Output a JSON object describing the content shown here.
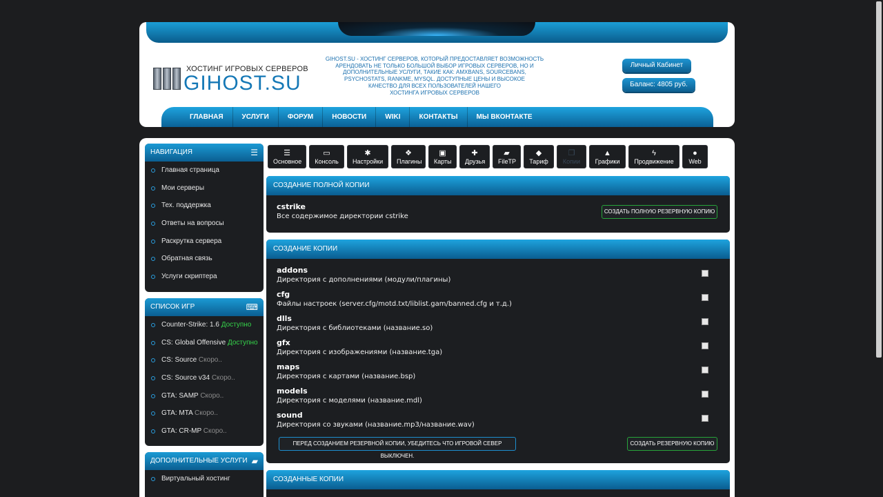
{
  "header": {
    "logo_subtitle": "ХОСТИНГ ИГРОВЫХ СЕРВЕРОВ",
    "logo_name": "GIHOST.SU",
    "description_lines": [
      "GIHOST.SU - ХОСТИНГ СЕРВЕРОВ, КОТОРЫЙ ПРЕДОСТАВЛЯЕТ ВОЗМОЖНОСТЬ",
      "АРЕНДОВАТЬ НЕ ТОЛЬКО БОЛЬШОЙ ВЫБОР ИГРОВЫХ СЕРВЕРОВ, НО И",
      "ДОПОЛНИТЕЛЬНЫЕ УСЛУГИ, ТАКИЕ КАК: AMXBANS, SOURCEBANS,",
      "PSYCHOSTATS, RANKME, MYSQL. ДОСТУПНЫЕ ЦЕНЫ И ВЫСОКОЕ",
      "КАЧЕСТВО ДЛЯ ВСЕХ ПОЛЬЗОВАТЕЛЕЙ НАШЕГО",
      "ХОСТИНГА ИГРОВЫХ СЕРВЕРОВ"
    ],
    "cabinet_label": "Личный Кабинет",
    "balance_label": "Баланс: 4805 руб.",
    "nav": [
      "ГЛАВНАЯ",
      "УСЛУГИ",
      "ФОРУМ",
      "НОВОСТИ",
      "WIKI",
      "КОНТАКТЫ",
      "МЫ ВКОНТАКТЕ"
    ]
  },
  "sidebar": {
    "navigation": {
      "title": "НАВИГАЦИЯ",
      "items": [
        "Главная страница",
        "Мои серверы",
        "Тех. поддержка",
        "Ответы на вопросы",
        "Раскрутка сервера",
        "Обратная связь",
        "Услуги скриптера"
      ]
    },
    "games": {
      "title": "СПИСОК ИГР",
      "items": [
        {
          "name": "Counter-Strike: 1.6",
          "status": "Доступно",
          "available": true
        },
        {
          "name": "CS: Global Offensive",
          "status": "Доступно",
          "available": true
        },
        {
          "name": "CS: Source",
          "status": "Скоро..",
          "available": false
        },
        {
          "name": "CS: Source v34",
          "status": "Скоро..",
          "available": false
        },
        {
          "name": "GTA: SAMP",
          "status": "Скоро..",
          "available": false
        },
        {
          "name": "GTA: MTA",
          "status": "Скоро..",
          "available": false
        },
        {
          "name": "GTA: CR-MP",
          "status": "Скоро..",
          "available": false
        }
      ]
    },
    "extra": {
      "title": "ДОПОЛНИТЕЛЬНЫЕ УСЛУГИ",
      "items": [
        "Виртуальный хостинг"
      ]
    }
  },
  "toolbar": [
    {
      "label": "Основное",
      "icon": "list-icon",
      "glyph": "☰"
    },
    {
      "label": "Консоль",
      "icon": "monitor-icon",
      "glyph": "▭"
    },
    {
      "label": "Настройки",
      "icon": "gear-icon",
      "glyph": "✱"
    },
    {
      "label": "Плагины",
      "icon": "cubes-icon",
      "glyph": "❖"
    },
    {
      "label": "Карты",
      "icon": "image-icon",
      "glyph": "▣"
    },
    {
      "label": "Друзья",
      "icon": "user-plus-icon",
      "glyph": "✚"
    },
    {
      "label": "FileTP",
      "icon": "folder-icon",
      "glyph": "▰"
    },
    {
      "label": "Тариф",
      "icon": "dropbox-icon",
      "glyph": "◆"
    },
    {
      "label": "Копии",
      "icon": "copy-icon",
      "glyph": "❐",
      "disabled": true
    },
    {
      "label": "Графики",
      "icon": "chart-icon",
      "glyph": "▲"
    },
    {
      "label": "Продвижение",
      "icon": "bolt-icon",
      "glyph": "ϟ"
    },
    {
      "label": "Web",
      "icon": "globe-icon",
      "glyph": "●"
    }
  ],
  "full_copy": {
    "title": "СОЗДАНИЕ ПОЛНОЙ КОПИИ",
    "name": "cstrike",
    "desc": "Все содержимое директории cstrike",
    "button": "СОЗДАТЬ ПОЛНУЮ РЕЗЕРВНУЮ КОПИЮ"
  },
  "copy": {
    "title": "СОЗДАНИЕ КОПИИ",
    "dirs": [
      {
        "name": "addons",
        "desc": "Директория с дополнениями (модули/плагины)"
      },
      {
        "name": "cfg",
        "desc": "Файлы настроек (server.cfg/motd.txt/liblist.gam/banned.cfg и т.д.)"
      },
      {
        "name": "dlls",
        "desc": "Директория с библиотеками (название.so)"
      },
      {
        "name": "gfx",
        "desc": "Директория с изображениями (название.tga)"
      },
      {
        "name": "maps",
        "desc": "Директория с картами (название.bsp)"
      },
      {
        "name": "models",
        "desc": "Директория с моделями (название.mdl)"
      },
      {
        "name": "sound",
        "desc": "Директория со звуками (название.mp3/название.wav)"
      }
    ],
    "warning": "ПЕРЕД СОЗДАНИЕМ РЕЗЕРВНОЙ КОПИИ, УБЕДИТЕСЬ ЧТО ИГРОВОЙ СЕВЕР ВЫКЛЮЧЕН.",
    "button": "СОЗДАТЬ РЕЗЕРВНУЮ КОПИЮ"
  },
  "created": {
    "title": "СОЗДАННЫЕ КОПИИ"
  },
  "colors": {
    "accent": "#1578b6",
    "available": "#35d44a",
    "soon": "#8c8c8c",
    "panel_bg": "#1c1e21"
  }
}
